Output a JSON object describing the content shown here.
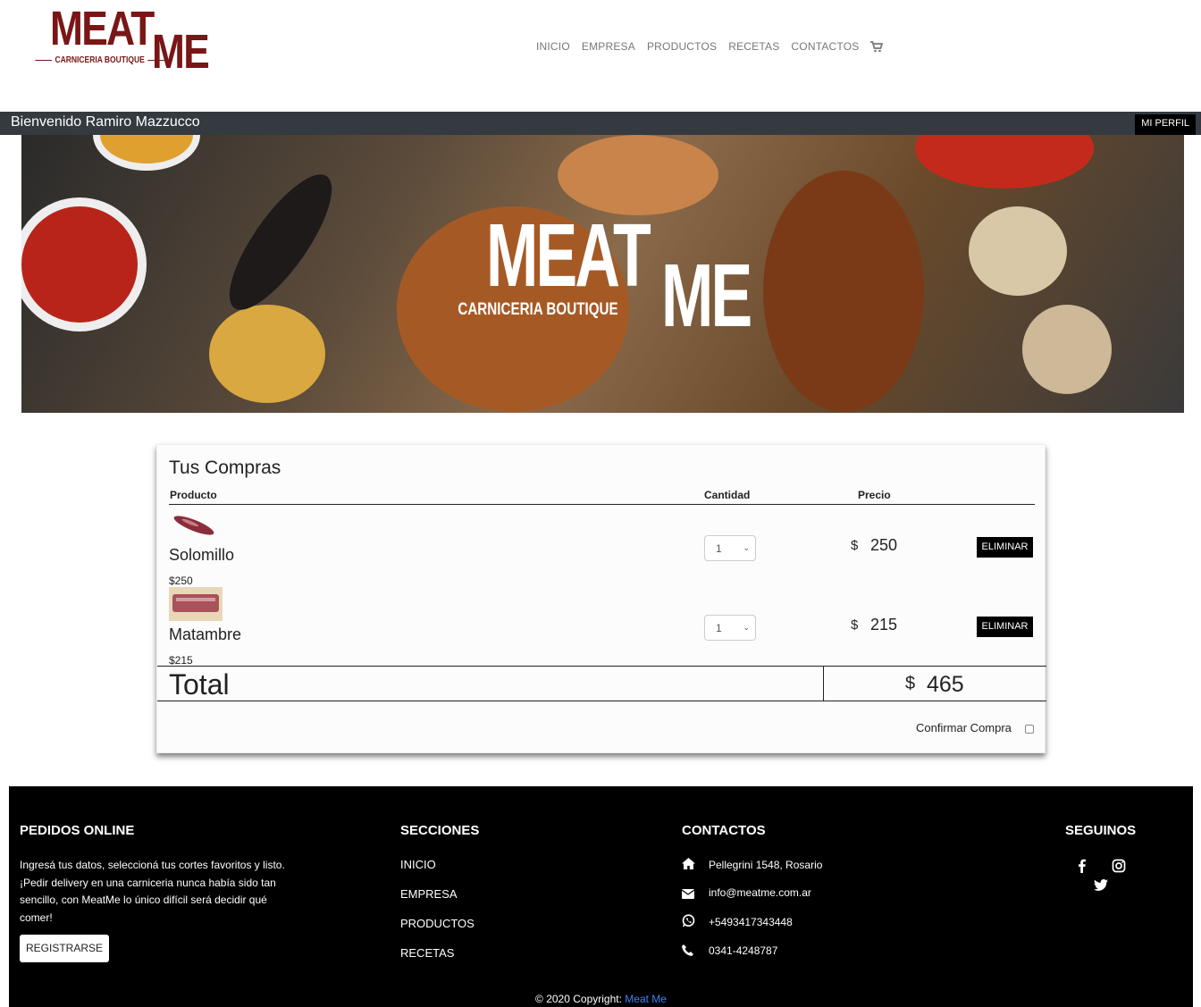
{
  "brand": {
    "logo_word1": "MEAT",
    "logo_word2": "ME",
    "logo_tagline": "CARNICERIA BOUTIQUE",
    "color": "#7a1616"
  },
  "nav": {
    "items": [
      "INICIO",
      "EMPRESA",
      "PRODUCTOS",
      "RECETAS",
      "CONTACTOS"
    ],
    "cart_icon": "shopping-cart-icon"
  },
  "welcome": {
    "text": "Bienvenido Ramiro Mazzucco",
    "profile_button": "MI PERFIL"
  },
  "hero": {
    "logo_word1": "MEAT",
    "logo_word2": "ME",
    "logo_tagline": "CARNICERIA BOUTIQUE"
  },
  "cart": {
    "title": "Tus Compras",
    "columns": {
      "product": "Producto",
      "quantity": "Cantidad",
      "price": "Precio"
    },
    "items": [
      {
        "name": "Solomillo",
        "unit_price": "$250",
        "quantity": "1",
        "currency": "$",
        "price": "250",
        "remove_label": "ELIMINAR"
      },
      {
        "name": "Matambre",
        "unit_price": "$215",
        "quantity": "1",
        "currency": "$",
        "price": "215",
        "remove_label": "ELIMINAR"
      }
    ],
    "total_label": "Total",
    "total_currency": "$",
    "total_value": "465",
    "confirm_label": "Confirmar Compra"
  },
  "footer": {
    "online": {
      "title": "PEDIDOS ONLINE",
      "text": "Ingresá tus datos, seleccioná tus cortes favoritos y listo. ¡Pedir delivery en una carniceria nunca había sido tan sencillo, con MeatMe lo único difícil será decidir qué comer!",
      "register_label": "REGISTRARSE"
    },
    "sections": {
      "title": "SECCIONES",
      "items": [
        "INICIO",
        "EMPRESA",
        "PRODUCTOS",
        "RECETAS"
      ]
    },
    "contacts": {
      "title": "CONTACTOS",
      "address": "Pellegrini 1548, Rosario",
      "email": "info@meatme.com.ar",
      "whatsapp": "+5493417343448",
      "phone": "0341-4248787"
    },
    "social": {
      "title": "SEGUINOS"
    },
    "copyright_prefix": "© 2020 Copyright:",
    "copyright_link": "Meat Me"
  }
}
